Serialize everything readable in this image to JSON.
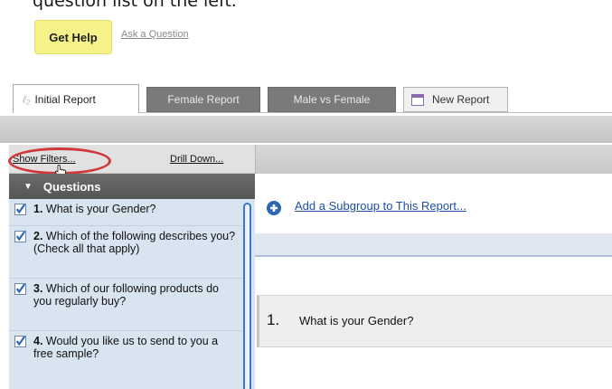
{
  "caption": "question list on the left.",
  "help": {
    "get_help": "Get Help",
    "ask_question": "Ask a Question"
  },
  "tabs": [
    {
      "label": "Initial Report",
      "icon": "report-icon",
      "active": true
    },
    {
      "label": "Female Report"
    },
    {
      "label": "Male vs Female"
    },
    {
      "label": "New Report",
      "icon": "new-report-icon"
    }
  ],
  "sidebar": {
    "show_filters": "Show Filters...",
    "drill_down": "Drill Down...",
    "questions_header": "Questions",
    "questions": [
      {
        "num": "1.",
        "text": "What is your Gender?",
        "checked": true
      },
      {
        "num": "2.",
        "text": "Which of the following describes you? (Check all that apply)",
        "checked": true
      },
      {
        "num": "3.",
        "text": "Which of our following products do you regularly buy?",
        "checked": true
      },
      {
        "num": "4.",
        "text": "Would you like us to send to you a free sample?",
        "checked": true
      }
    ]
  },
  "main": {
    "add_subgroup": "Add a Subgroup to This Report...",
    "question_row": {
      "num": "1.",
      "text": "What is your Gender?"
    }
  },
  "colors": {
    "accent_red": "#d1383a",
    "link_blue": "#1d4fa8",
    "check_blue": "#2f67b5",
    "help_yellow": "#f6f28a"
  }
}
